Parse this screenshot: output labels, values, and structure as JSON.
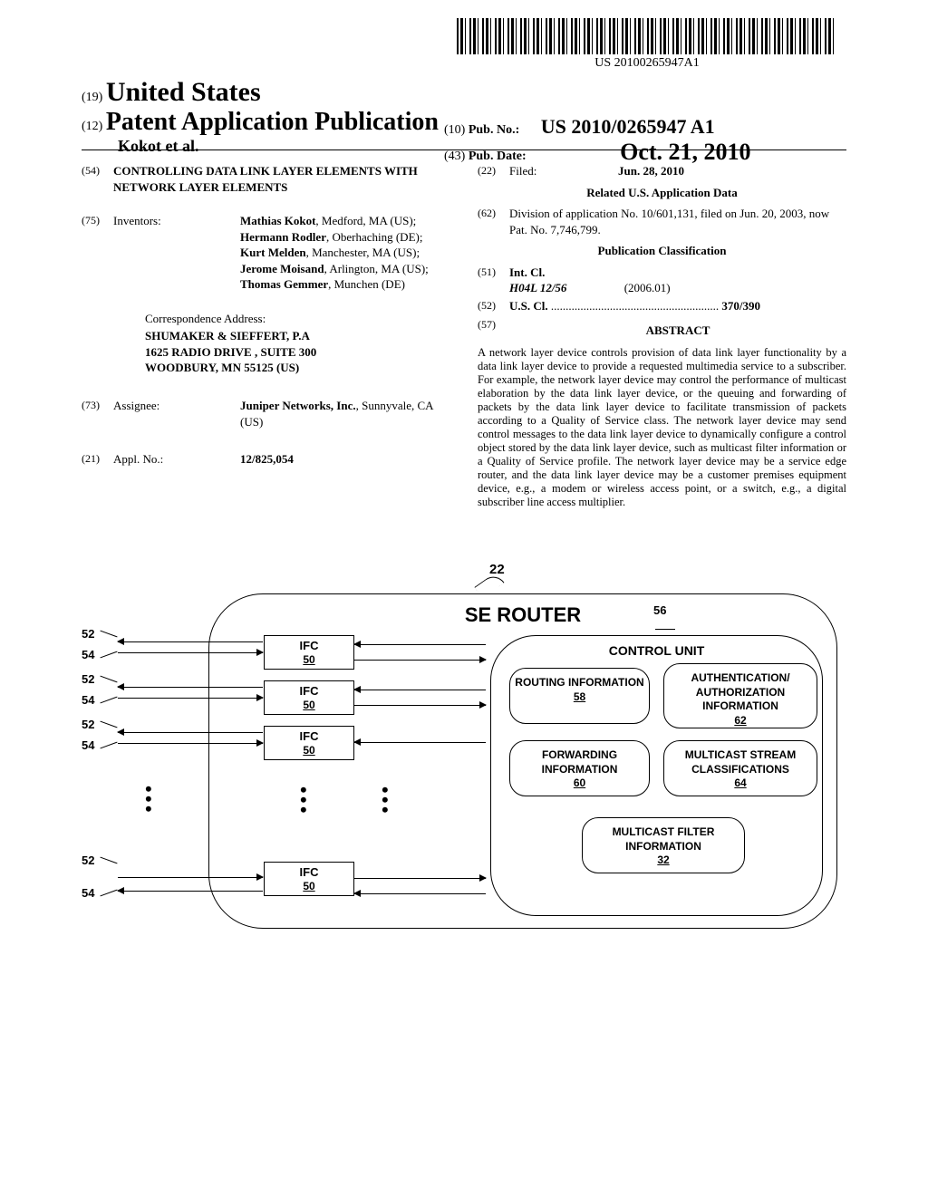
{
  "barcode_text": "US 20100265947A1",
  "header": {
    "code19": "(19)",
    "country": "United States",
    "code12": "(12)",
    "pub_type": "Patent Application Publication",
    "author_line": "Kokot et al.",
    "code10": "(10)",
    "pub_no_label": "Pub. No.:",
    "pub_no": "US 2010/0265947 A1",
    "code43": "(43)",
    "pub_date_label": "Pub. Date:",
    "pub_date": "Oct. 21, 2010"
  },
  "left": {
    "code54": "(54)",
    "title": "CONTROLLING DATA LINK LAYER ELEMENTS WITH NETWORK LAYER ELEMENTS",
    "code75": "(75)",
    "inventors_label": "Inventors:",
    "inventors": "Mathias Kokot, Medford, MA (US); Hermann Rodler, Oberhaching (DE); Kurt Melden, Manchester, MA (US); Jerome Moisand, Arlington, MA (US); Thomas Gemmer, Munchen (DE)",
    "corr_label": "Correspondence Address:",
    "corr1": "SHUMAKER & SIEFFERT, P.A",
    "corr2": "1625 RADIO DRIVE , SUITE 300",
    "corr3": "WOODBURY, MN 55125 (US)",
    "code73": "(73)",
    "assignee_label": "Assignee:",
    "assignee": "Juniper Networks, Inc., Sunnyvale, CA (US)",
    "code21": "(21)",
    "applno_label": "Appl. No.:",
    "applno": "12/825,054"
  },
  "right": {
    "code22": "(22)",
    "filed_label": "Filed:",
    "filed": "Jun. 28, 2010",
    "related_heading": "Related U.S. Application Data",
    "code62": "(62)",
    "related": "Division of application No. 10/601,131, filed on Jun. 20, 2003, now Pat. No. 7,746,799.",
    "class_heading": "Publication Classification",
    "code51": "(51)",
    "intcl_label": "Int. Cl.",
    "intcl_val": "H04L 12/56",
    "intcl_ver": "(2006.01)",
    "code52": "(52)",
    "uscl_label": "U.S. Cl.",
    "uscl_val": "370/390",
    "code57": "(57)",
    "abstract_label": "ABSTRACT",
    "abstract": "A network layer device controls provision of data link layer functionality by a data link layer device to provide a requested multimedia service to a subscriber. For example, the network layer device may control the performance of multicast elaboration by the data link layer device, or the queuing and forwarding of packets by the data link layer device to facilitate transmission of packets according to a Quality of Service class. The network layer device may send control messages to the data link layer device to dynamically configure a control object stored by the data link layer device, such as multicast filter information or a Quality of Service profile. The network layer device may be a service edge router, and the data link layer device may be a customer premises equipment device, e.g., a modem or wireless access point, or a switch, e.g., a digital subscriber line access multiplier."
  },
  "figure": {
    "ref22": "22",
    "router": "SE ROUTER",
    "ref56": "56",
    "control_unit": "CONTROL UNIT",
    "ifc": "IFC",
    "ifc_num": "50",
    "ref52": "52",
    "ref54": "54",
    "routing_info": "ROUTING INFORMATION",
    "routing_num": "58",
    "auth_info": "AUTHENTICATION/ AUTHORIZATION INFORMATION",
    "auth_num": "62",
    "fwd_info": "FORWARDING INFORMATION",
    "fwd_num": "60",
    "mcast_class": "MULTICAST STREAM CLASSIFICATIONS",
    "mcast_class_num": "64",
    "mcast_filter": "MULTICAST FILTER INFORMATION",
    "mcast_filter_num": "32"
  }
}
